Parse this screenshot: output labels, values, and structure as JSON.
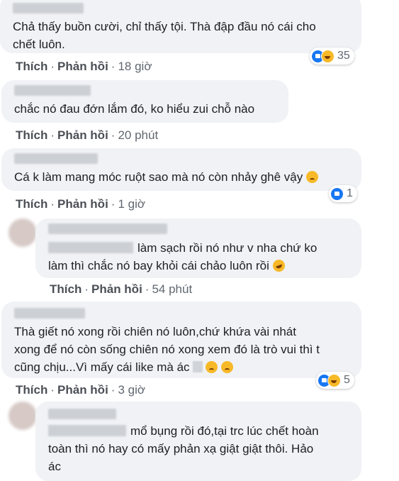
{
  "labels": {
    "like": "Thích",
    "reply": "Phản hồi",
    "dot": "·"
  },
  "comments": [
    {
      "text": "Chả thấy buồn cười, chỉ thấy tội. Thà đập đầu nó cái cho\nchết luôn.",
      "time": "18 giờ",
      "reaction_count": "35",
      "reaction_icons": [
        "like-icon",
        "haha-icon"
      ]
    },
    {
      "text": "chắc nó đau đớn lắm đó, ko hiểu zui chỗ nào",
      "time": "20 phút"
    },
    {
      "text": "Cá k làm mang móc ruột sao mà nó còn nhảy ghê vậy",
      "time": "1 giờ",
      "reaction_count": "1",
      "reaction_icons": [
        "like-icon"
      ]
    },
    {
      "text": "làm sạch rồi nó như v nha chứ ko\nlàm thì chắc nó bay khỏi cái chảo luôn rồi",
      "time": "54 phút"
    },
    {
      "text": "Thà giết nó xong rồi chiên nó luôn,chứ khứa vài nhát\nxong để nó còn sống chiên nó xong xem đó là trò vui thì t\ncũng chịu...Vì mấy cái like mà ác",
      "time": "3 giờ",
      "reaction_count": "5",
      "reaction_icons": [
        "like-icon",
        "haha-icon"
      ]
    },
    {
      "text": "mổ bụng rồi đó,tại trc lúc chết hoàn\ntoàn thì nó hay có mấy phản xạ giật giật thôi. Hảo\nác"
    }
  ],
  "colors": {
    "bubble": "#f0f2f5",
    "action": "#4b4f56",
    "meta": "#606770",
    "like_blue": "#1877f2",
    "emoji_yellow": "#f7b928"
  }
}
